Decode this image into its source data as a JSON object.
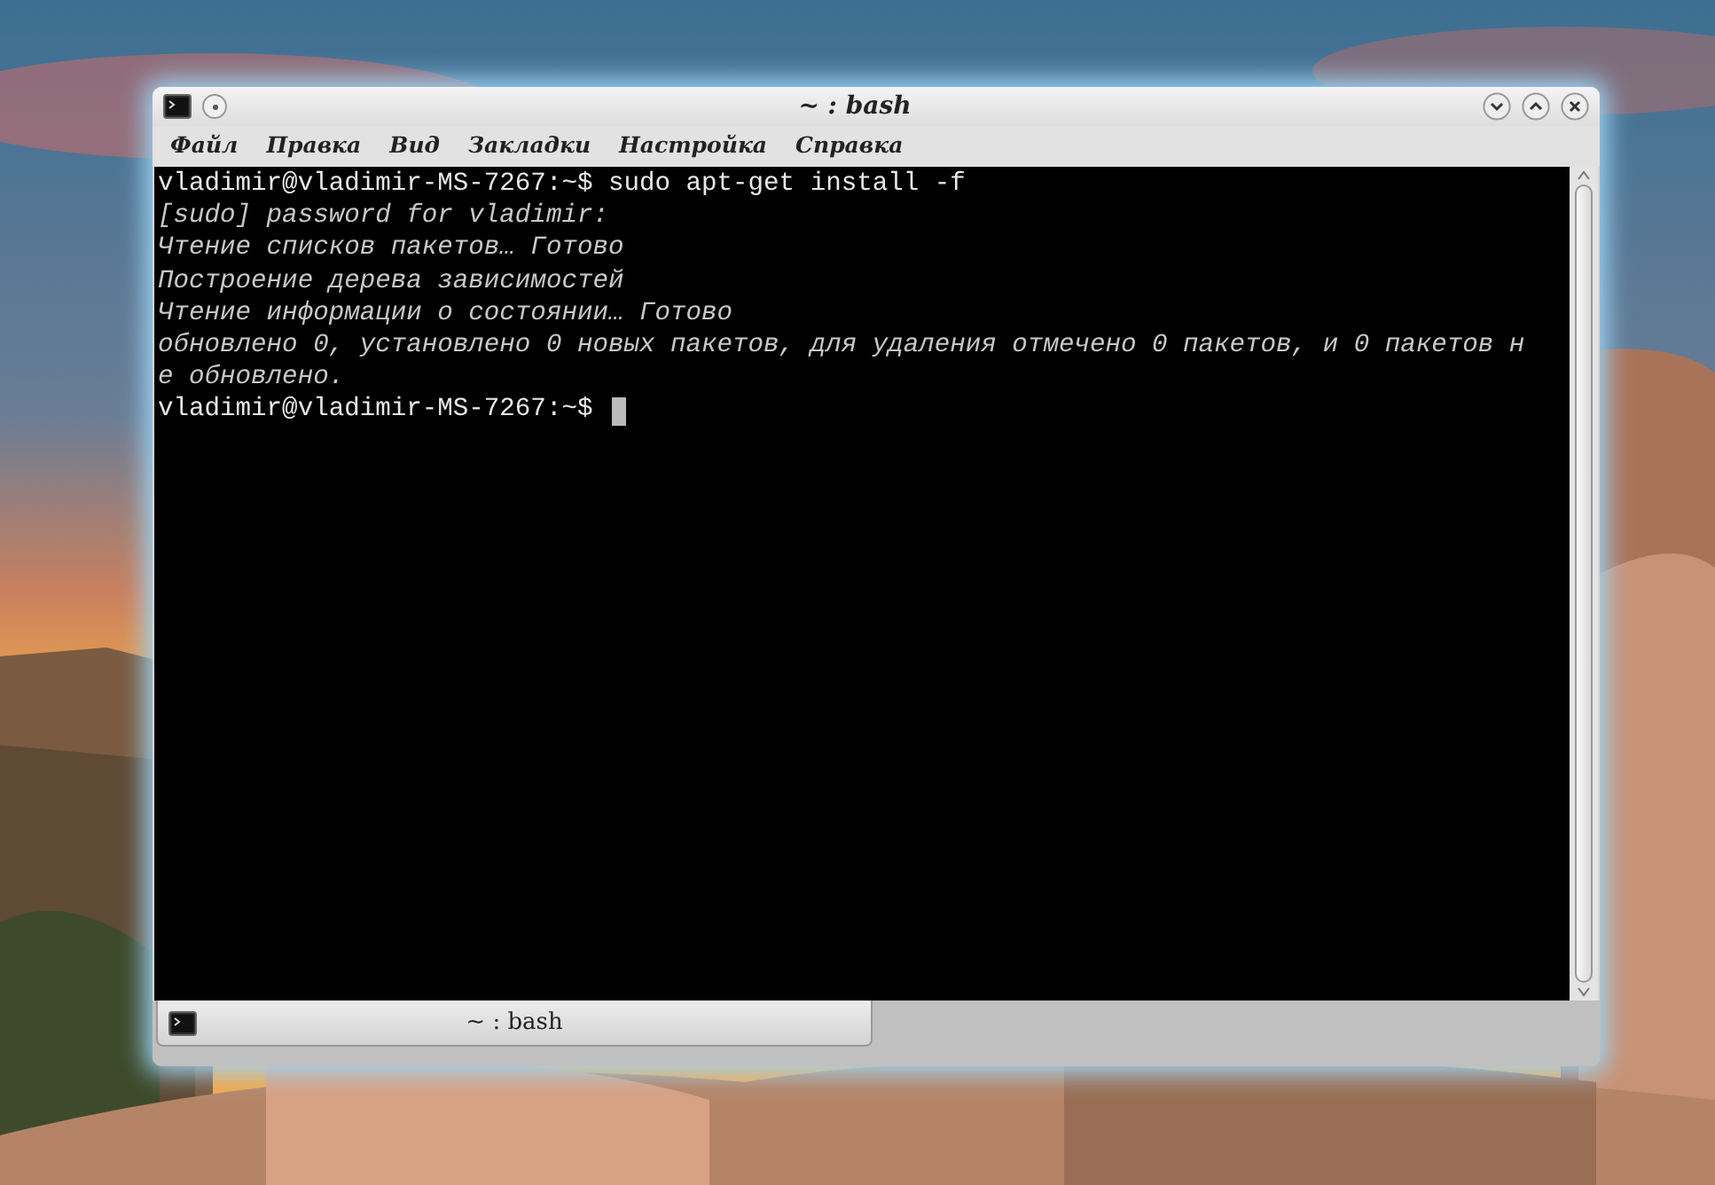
{
  "window": {
    "title": "~ : bash"
  },
  "menu": [
    {
      "label": "Файл"
    },
    {
      "label": "Правка"
    },
    {
      "label": "Вид"
    },
    {
      "label": "Закладки"
    },
    {
      "label": "Настройка"
    },
    {
      "label": "Справка"
    }
  ],
  "terminal": {
    "lines": [
      {
        "kind": "command",
        "text": "vladimir@vladimir-MS-7267:~$ sudo apt-get install -f"
      },
      {
        "kind": "output",
        "text": "[sudo] password for vladimir:"
      },
      {
        "kind": "output",
        "text": "Чтение списков пакетов… Готово"
      },
      {
        "kind": "output",
        "text": "Построение дерева зависимостей"
      },
      {
        "kind": "output",
        "text": "Чтение информации о состоянии… Готово"
      },
      {
        "kind": "output",
        "text": "обновлено 0, установлено 0 новых пакетов, для удаления отмечено 0 пакетов, и 0 пакетов н"
      },
      {
        "kind": "output",
        "text": "е обновлено."
      },
      {
        "kind": "prompt",
        "text": "vladimir@vladimir-MS-7267:~$ "
      }
    ]
  },
  "tabs": [
    {
      "label": "~ : bash",
      "selected": true
    }
  ]
}
